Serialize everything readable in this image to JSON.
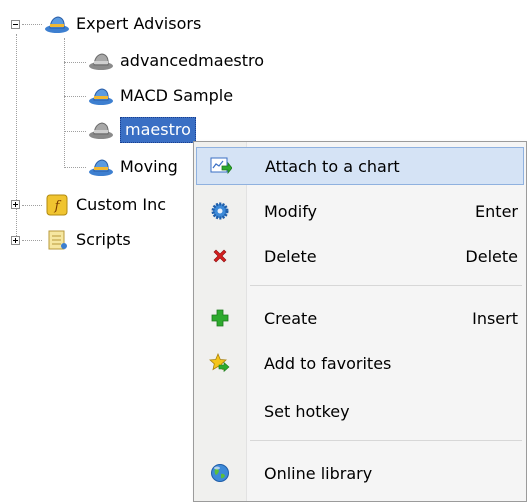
{
  "tree": {
    "expert_advisors": "Expert Advisors",
    "advancedmaestro": "advancedmaestro",
    "macd_sample": "MACD Sample",
    "maestro": "maestro",
    "moving_partial": "Moving",
    "custom_indicators_partial": "Custom Inc",
    "scripts": "Scripts"
  },
  "context_menu": {
    "items": [
      {
        "label": "Attach to a chart",
        "shortcut": "",
        "icon": "attach-chart-icon"
      },
      {
        "label": "Modify",
        "shortcut": "Enter",
        "icon": "gear-icon"
      },
      {
        "label": "Delete",
        "shortcut": "Delete",
        "icon": "red-x-icon"
      },
      {
        "label": "Create",
        "shortcut": "Insert",
        "icon": "green-plus-icon"
      },
      {
        "label": "Add to favorites",
        "shortcut": "",
        "icon": "star-arrow-icon"
      },
      {
        "label": "Set hotkey",
        "shortcut": "",
        "icon": ""
      },
      {
        "label": "Online library",
        "shortcut": "",
        "icon": "globe-icon"
      }
    ]
  },
  "colors": {
    "selection": "#3a6fc4",
    "menu_hover": "#d5e3f5",
    "delete_icon": "#d42020",
    "create_icon": "#2eaa2e"
  }
}
